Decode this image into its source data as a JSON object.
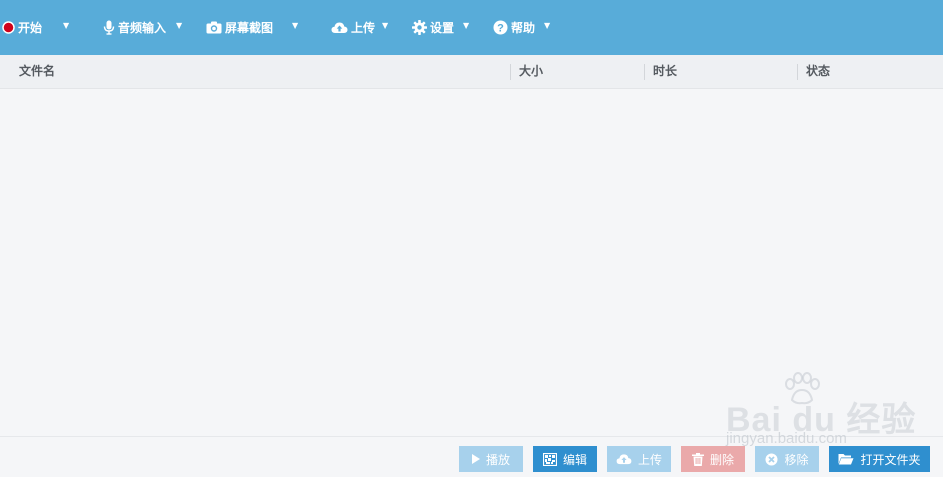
{
  "toolbar": {
    "start": {
      "label": "开始",
      "icon": "record-icon"
    },
    "audio_input": {
      "label": "音频输入",
      "icon": "microphone-icon"
    },
    "screenshot": {
      "label": "屏幕截图",
      "icon": "camera-icon"
    },
    "upload": {
      "label": "上传",
      "icon": "cloud-upload-icon"
    },
    "settings": {
      "label": "设置",
      "icon": "gear-icon"
    },
    "help": {
      "label": "帮助",
      "icon": "question-icon"
    }
  },
  "table": {
    "columns": {
      "filename": "文件名",
      "size": "大小",
      "duration": "时长",
      "status": "状态"
    },
    "rows": []
  },
  "actions": {
    "play": "播放",
    "edit": "编辑",
    "upload": "上传",
    "delete": "删除",
    "remove": "移除",
    "open_folder": "打开文件夹"
  },
  "watermark": {
    "main": "Bai du 经验",
    "sub": "jingyan.baidu.com"
  },
  "colors": {
    "toolbar_bg": "#58acd9",
    "primary_button": "#2f8fcf",
    "disabled_button": "#a7d1ec",
    "delete_button": "#eaa9aa",
    "record_red": "#d0021b"
  }
}
